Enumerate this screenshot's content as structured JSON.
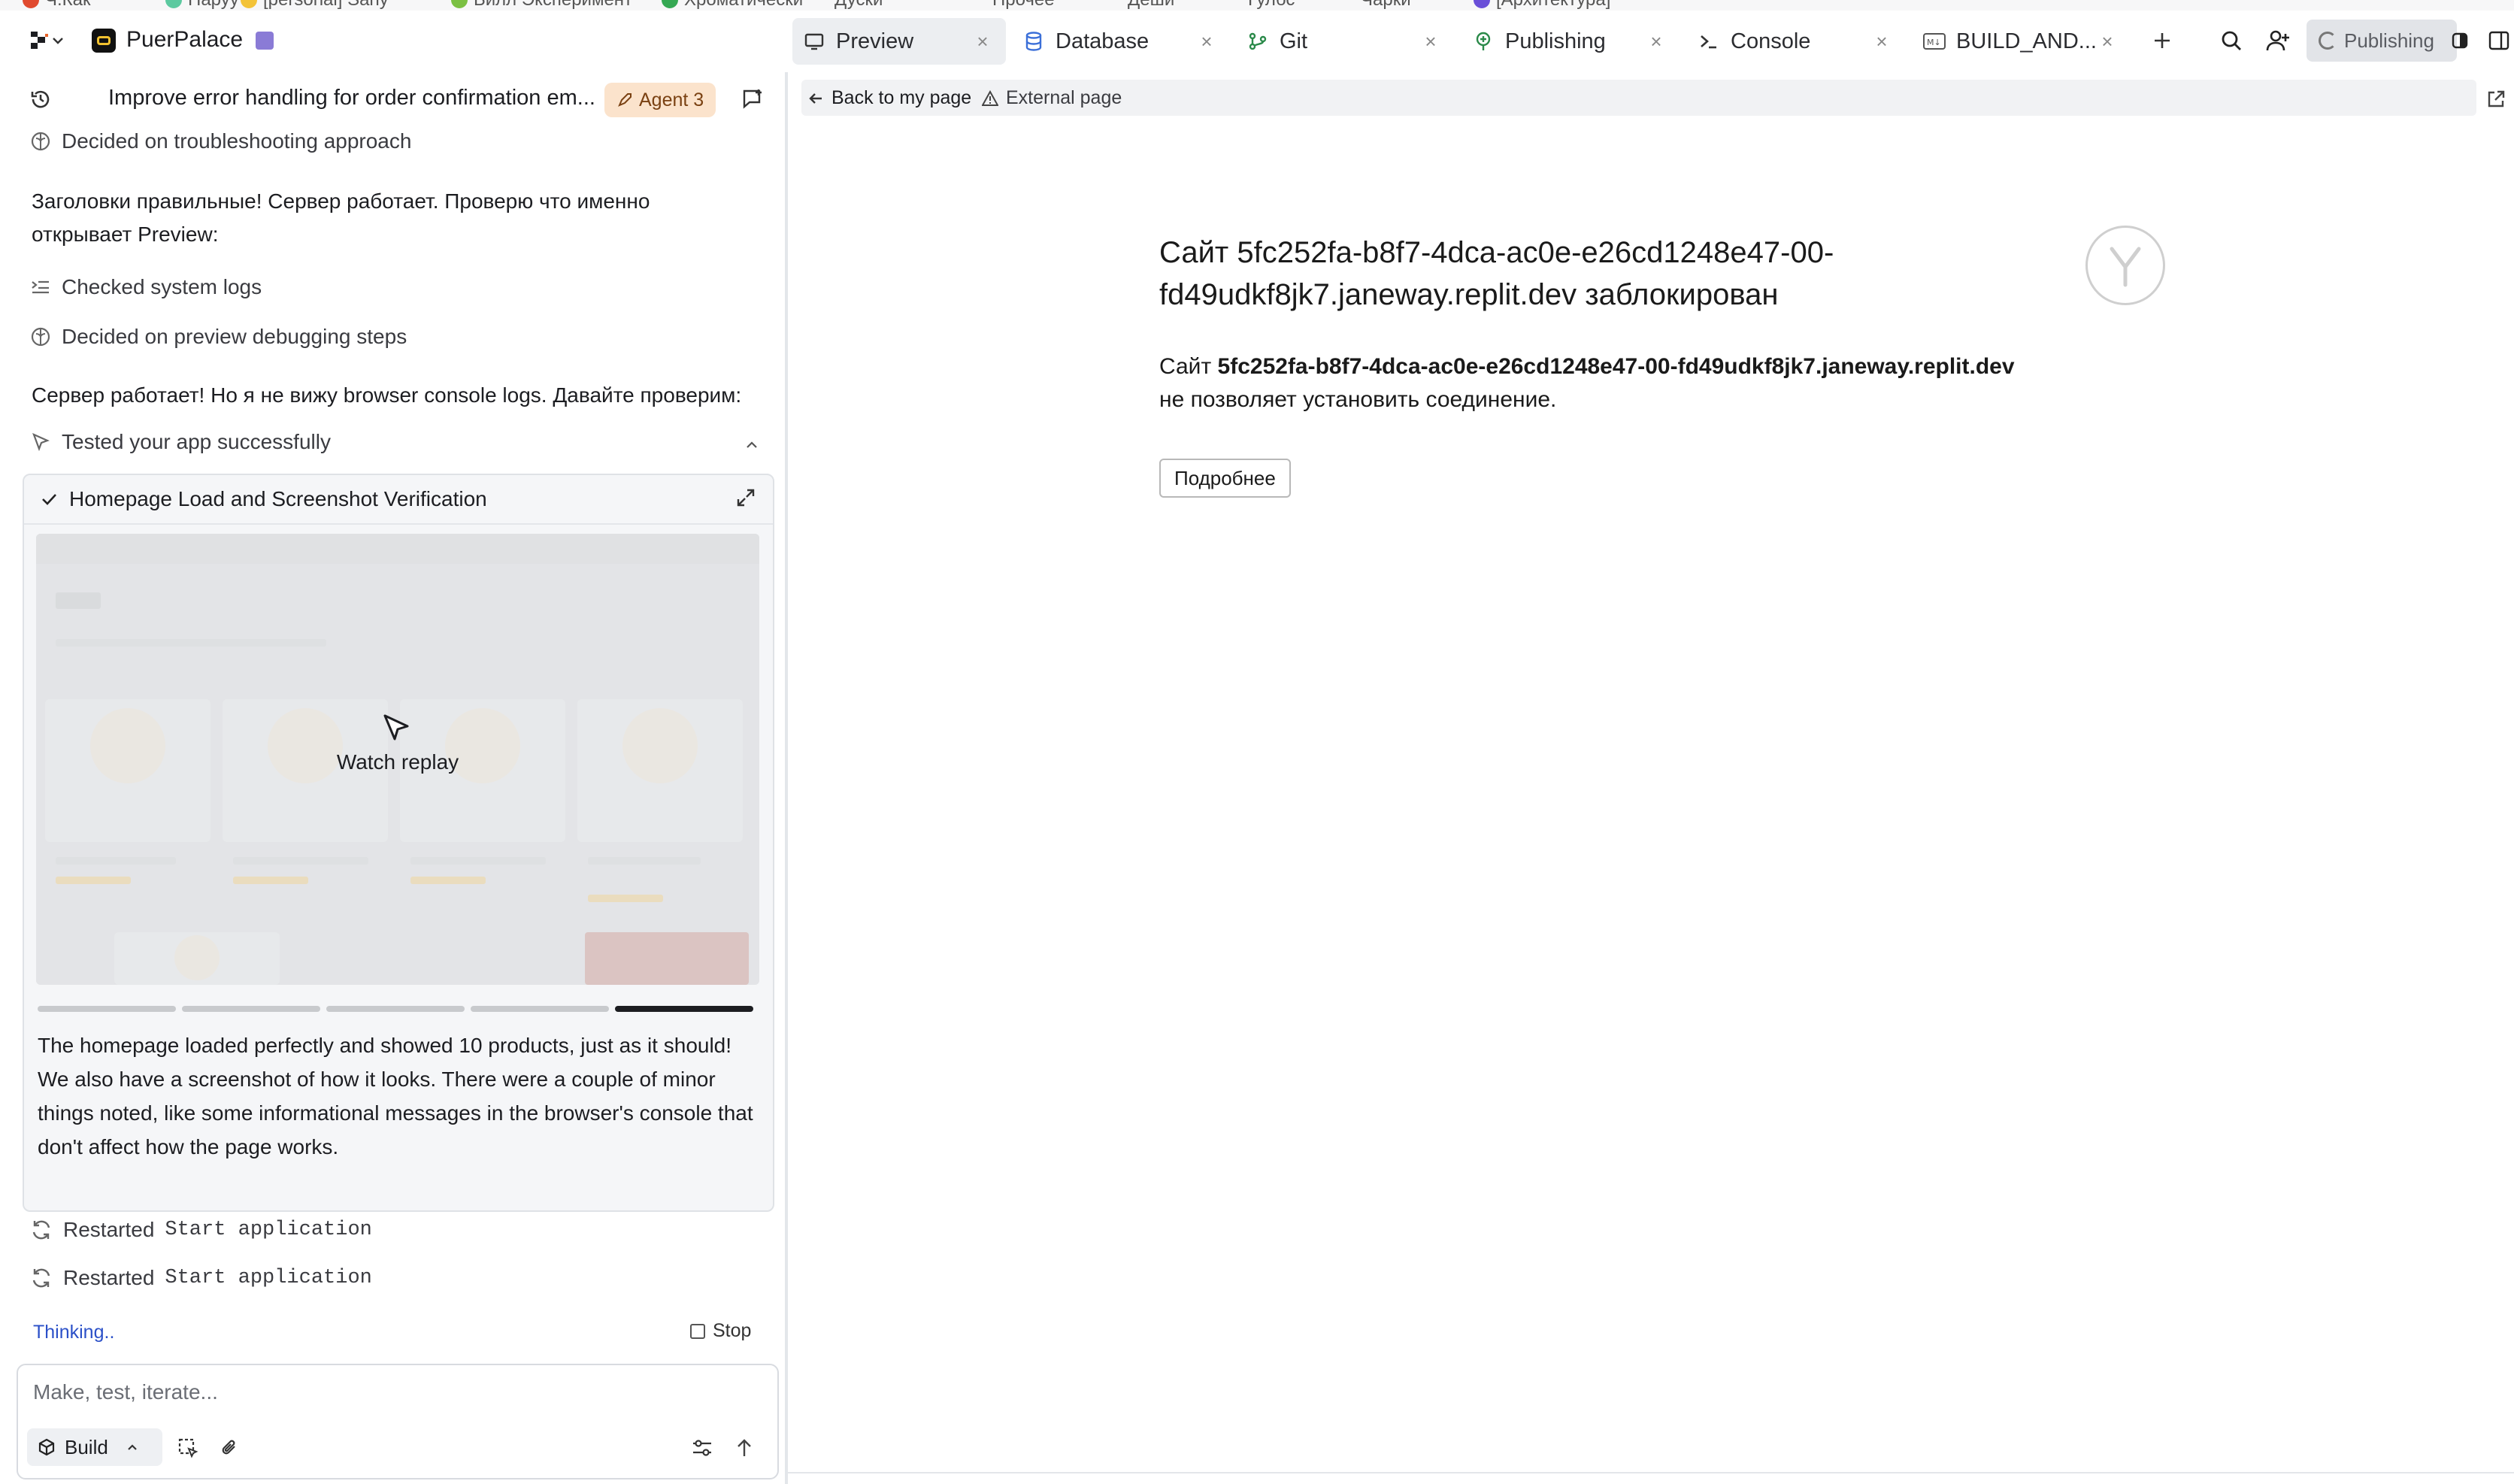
{
  "bookmarks": [
    "Ч.Как",
    "Наруу",
    "[personal] Sany",
    "Билл Эксперимент",
    "Хроматически",
    "Дуски",
    "Прочее",
    "Деши",
    "Гулбс",
    "Чарки",
    "[Архитектура]"
  ],
  "app": {
    "name": "PuerPalace"
  },
  "tabs": [
    {
      "label": "Preview",
      "icon": "monitor-icon",
      "active": true
    },
    {
      "label": "Database",
      "icon": "database-icon"
    },
    {
      "label": "Git",
      "icon": "git-icon"
    },
    {
      "label": "Publishing",
      "icon": "publishing-icon"
    },
    {
      "label": "Console",
      "icon": "terminal-icon"
    },
    {
      "label": "BUILD_AND...",
      "icon": "markdown-icon"
    }
  ],
  "topbar": {
    "publishing_label": "Publishing"
  },
  "chat": {
    "title": "Improve error handling for order confirmation em...",
    "agent_badge": "Agent 3",
    "items": [
      {
        "type": "action",
        "icon": "brain-icon",
        "text": "Decided on troubleshooting approach"
      },
      {
        "type": "message",
        "text": "Заголовки правильные! Сервер работает. Проверю что именно открывает Preview:"
      },
      {
        "type": "action",
        "icon": "logs-icon",
        "text": "Checked system logs"
      },
      {
        "type": "action",
        "icon": "brain-icon",
        "text": "Decided on preview debugging steps"
      },
      {
        "type": "message",
        "text": "Сервер работает! Но я не вижу browser console logs. Давайте проверим:"
      },
      {
        "type": "action",
        "icon": "cursor-icon",
        "text": "Tested your app successfully"
      }
    ],
    "test_card": {
      "title": "Homepage Load and Screenshot Verification",
      "watch_label": "Watch replay",
      "progress_segments": 5,
      "active_segment": 5,
      "summary": "The homepage loaded perfectly and showed 10 products, just as it should! We also have a screenshot of how it looks. There were a couple of minor things noted, like some informational messages in the browser's console that don't affect how the page works."
    },
    "restarted": [
      {
        "prefix": "Restarted",
        "command": "Start application"
      },
      {
        "prefix": "Restarted",
        "command": "Start application"
      }
    ],
    "status": "Thinking..",
    "stop_label": "Stop",
    "input": {
      "placeholder": "Make, test, iterate...",
      "mode_label": "Build"
    }
  },
  "preview": {
    "back_label": "Back to my page",
    "external_label": "External page",
    "error": {
      "title": "Сайт 5fc252fa-b8f7-4dca-ac0e-e26cd1248e47-00-fd49udkf8jk7.janeway.replit.dev заблокирован",
      "body_prefix": "Сайт",
      "body_host": "5fc252fa-b8f7-4dca-ac0e-e26cd1248e47-00-fd49udkf8jk7.janeway.replit.dev",
      "body_suffix": "не позволяет установить соединение.",
      "more_button": "Подробнее"
    }
  },
  "colors": {
    "accent_badge_bg": "#fbe3cc",
    "thinking_blue": "#2b50c8",
    "divider": "#e3e6ea"
  }
}
